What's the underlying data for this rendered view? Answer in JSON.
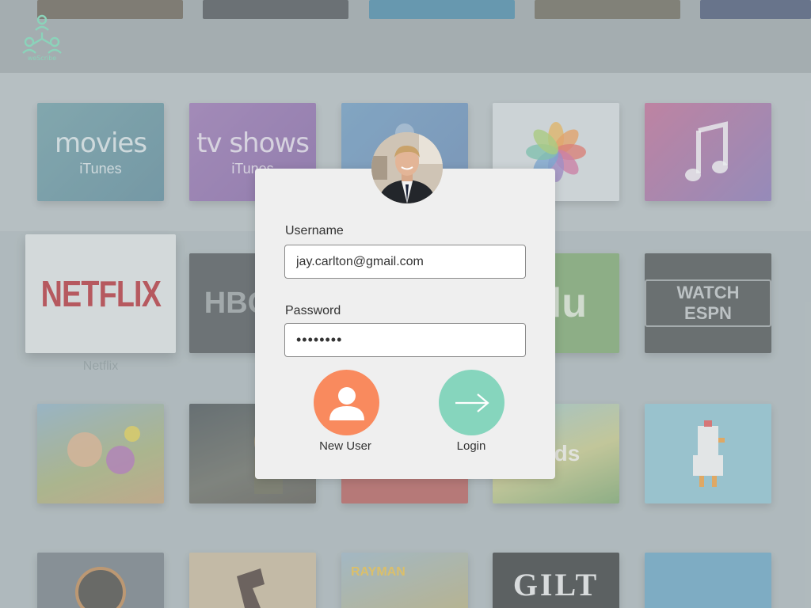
{
  "app": {
    "logo_text": "weScribe",
    "brand_color": "#8bd3ba"
  },
  "background_tiles": {
    "movies": {
      "title": "movies",
      "subtitle": "iTunes"
    },
    "tvshows": {
      "title": "tv shows",
      "subtitle": "iTunes"
    },
    "netflix": {
      "logo": "NETFLIX",
      "caption": "Netflix"
    },
    "hbo": {
      "label": "HBO N"
    },
    "hulu": {
      "label": "ulu"
    },
    "espn": {
      "label": "WATCH ESPN"
    },
    "kids": {
      "label": "Kids"
    },
    "gilt": {
      "label": "GILT"
    },
    "rayman": {
      "label": "RAYMAN"
    }
  },
  "login": {
    "username_label": "Username",
    "username_value": "jay.carlton@gmail.com",
    "password_label": "Password",
    "password_value": "••••••••",
    "new_user_label": "New User",
    "login_label": "Login",
    "new_user_color": "#f98a5e",
    "login_color": "#86d5bd",
    "new_user_icon": "person-icon",
    "login_icon": "arrow-right-icon"
  }
}
